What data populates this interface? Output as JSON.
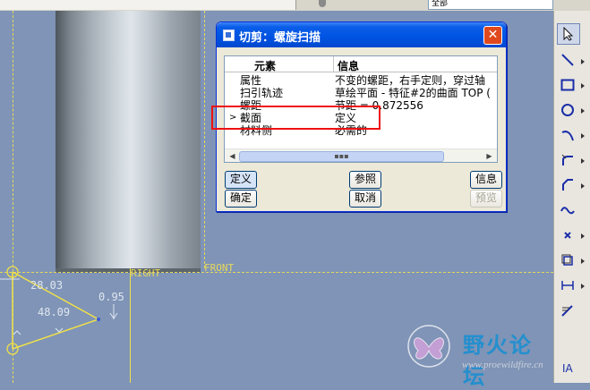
{
  "topbar": {
    "dropdown_text": "全部"
  },
  "dialog": {
    "title": "切剪：螺旋扫描",
    "close_glyph": "✕",
    "table": {
      "headers": {
        "element": "元素",
        "info": "信息"
      },
      "rows": [
        {
          "element": "属性",
          "info": "不变的螺距，右手定则，穿过轴",
          "marker": ""
        },
        {
          "element": "扫引轨迹",
          "info": "草绘平面 - 特征#2的曲面 TOP  (",
          "marker": ""
        },
        {
          "element": "螺距",
          "info": "节距 = 0.872556",
          "marker": ""
        },
        {
          "element": "截面",
          "info": "定义",
          "marker": ">"
        },
        {
          "element": "材料侧",
          "info": "必需的",
          "marker": ""
        }
      ]
    },
    "scroll_grip": "▪▪▪",
    "buttons": {
      "define": "定义",
      "reference": "参照",
      "info": "信息",
      "ok": "确定",
      "cancel": "取消",
      "preview": "预览"
    }
  },
  "canvas": {
    "datum_right": "RIGHT",
    "datum_front": "FRONT",
    "dim_1": "28.03",
    "dim_2": "0.95",
    "dim_3": "48.09"
  },
  "watermark": {
    "brand": "野火论坛",
    "url": "www.proewildfire.cn"
  },
  "toolbar_tools": [
    "select-arrow-icon",
    "line-icon",
    "rectangle-icon",
    "circle-icon",
    "arc-icon",
    "fillet-icon",
    "chamfer-icon",
    "spline-icon",
    "point-icon",
    "offset-icon",
    "dimension-icon",
    "modify-icon",
    "text-icon"
  ],
  "colors": {
    "canvas_bg": "#7f94b6",
    "datum_yellow": "#e8d85a",
    "titlebar_blue": "#0054e3",
    "highlight_red": "#ee1111"
  }
}
